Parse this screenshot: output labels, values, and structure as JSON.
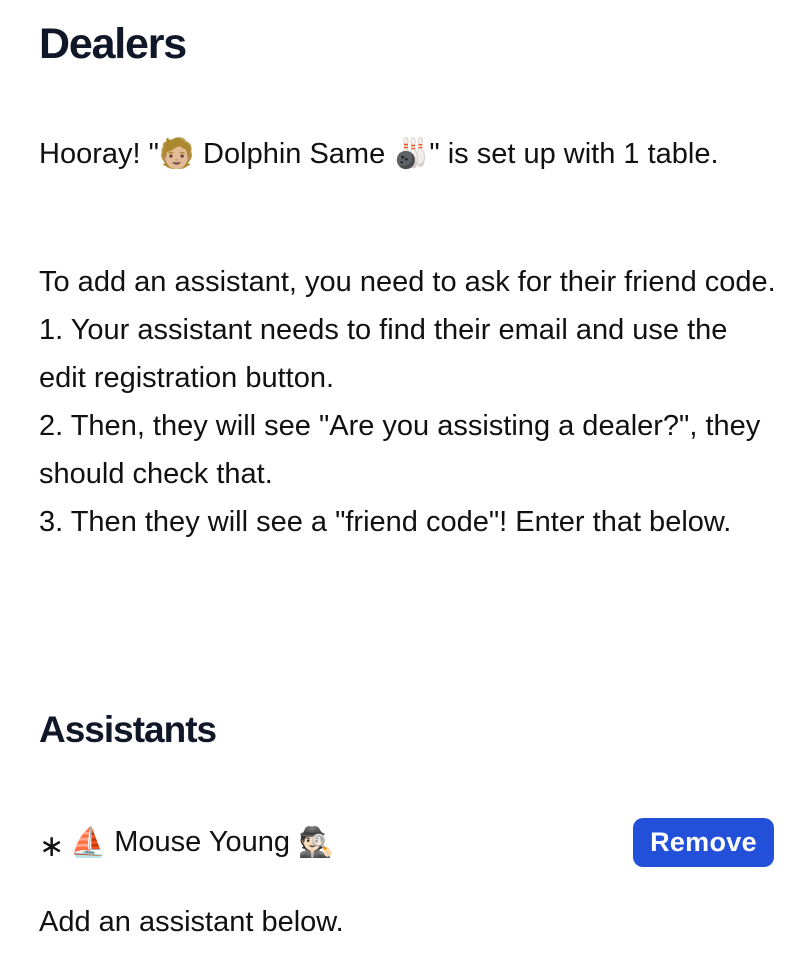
{
  "page": {
    "title": "Dealers"
  },
  "hooray": {
    "text": "Hooray! \"🧑🏼 Dolphin Same 🎳\" is set up with 1 table."
  },
  "instructions": {
    "lines": [
      "To add an assistant, you need to ask for their friend code.",
      "1. Your assistant needs to find their email and use the edit registration button.",
      "2. Then, they will see \"Are you assisting a dealer?\", they should check that.",
      "3. Then they will see a \"friend code\"! Enter that below."
    ]
  },
  "assistants": {
    "title": "Assistants",
    "items": [
      {
        "bullet": "∗",
        "emoji_left": "⛵",
        "name": "Mouse Young",
        "emoji_right": "🕵🏻",
        "remove_label": "Remove"
      }
    ],
    "add_note": "Add an assistant below."
  },
  "colors": {
    "accent": "#2350d8",
    "heading": "#101728"
  }
}
